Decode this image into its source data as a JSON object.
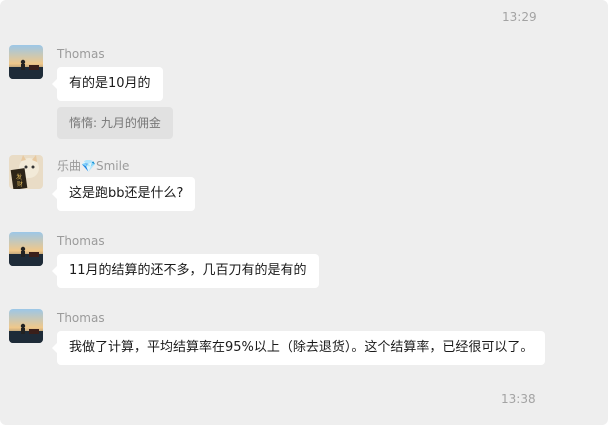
{
  "timestamps": {
    "top": "13:29",
    "bottom": "13:38"
  },
  "messages": [
    {
      "sender": "Thomas",
      "text": "有的是10月的",
      "quote": "惰惰: 九月的佣金"
    },
    {
      "sender_prefix": "乐曲",
      "sender_suffix": "Smile",
      "text": "这是跑bb还是什么?"
    },
    {
      "sender": "Thomas",
      "text": "11月的结算的还不多，几百刀有的是有的"
    },
    {
      "sender": "Thomas",
      "text": "我做了计算，平均结算率在95%以上（除去退货）。这个结算率，已经很可以了。"
    }
  ],
  "icons": {
    "gem": "diamond-icon"
  }
}
